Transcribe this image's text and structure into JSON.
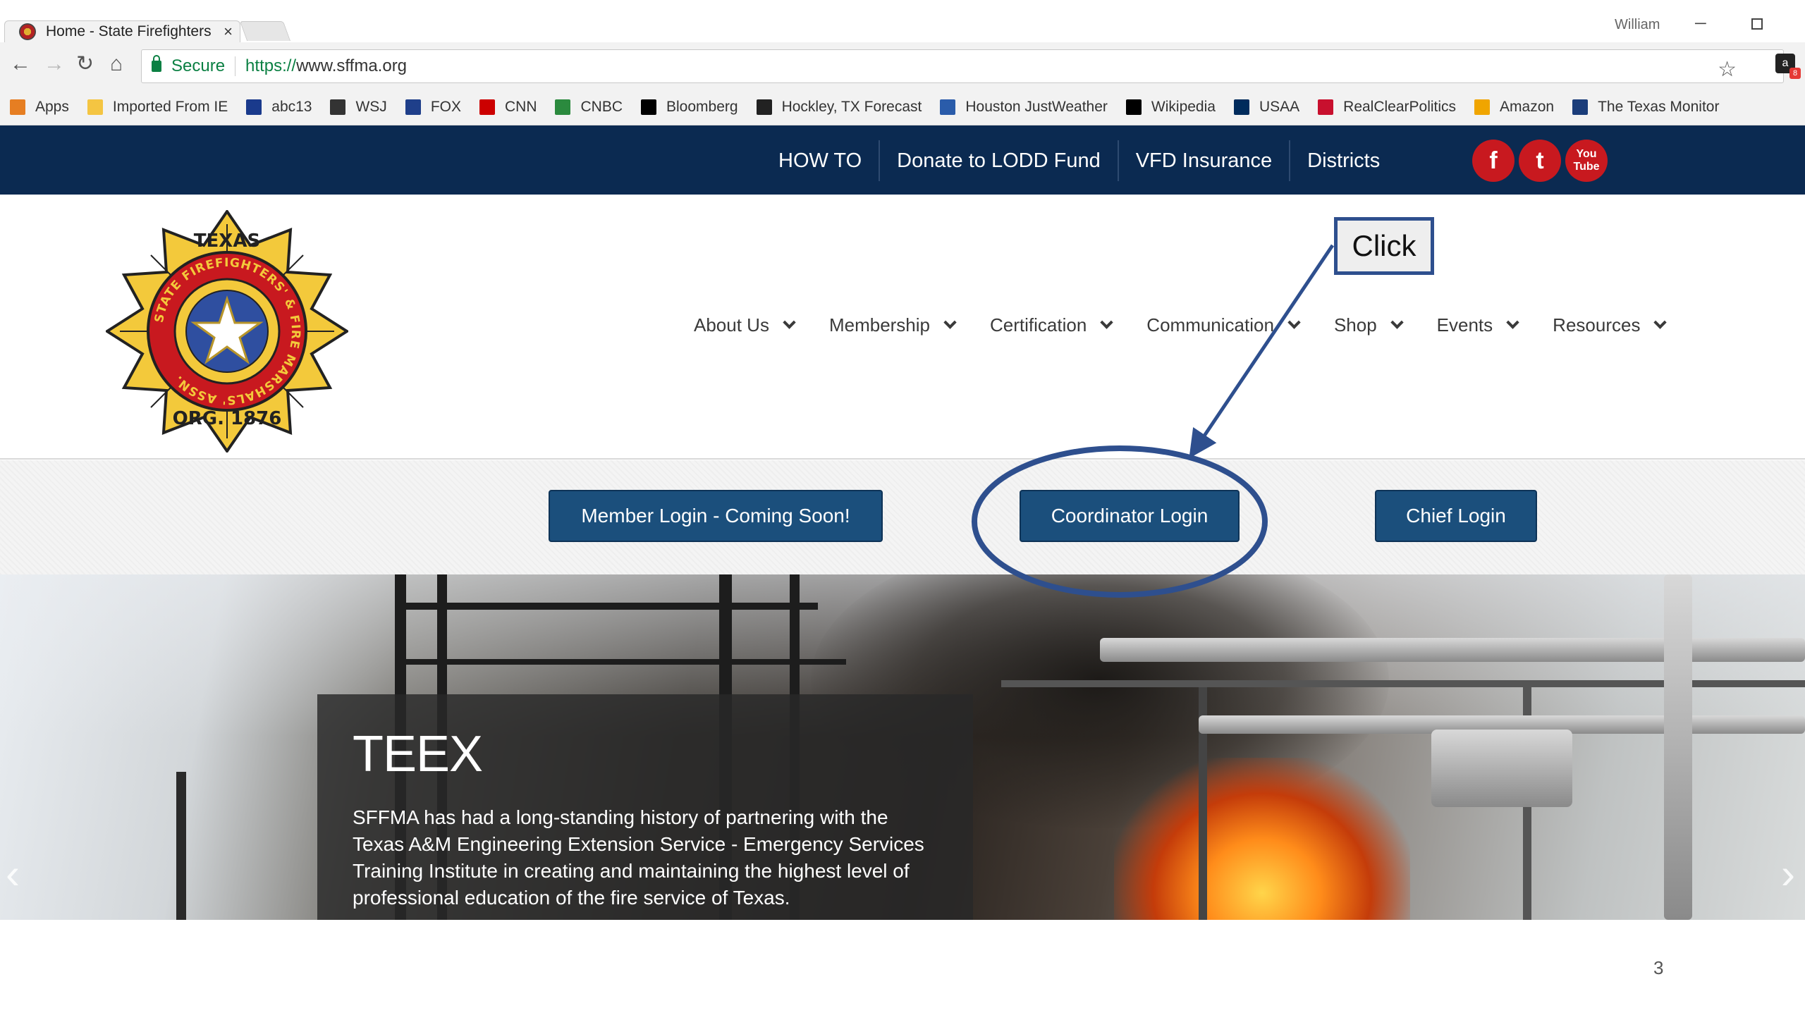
{
  "browser": {
    "tab_title": "Home - State Firefighters",
    "tab_close": "×",
    "user_name": "William",
    "minimize": "─",
    "secure_label": "Secure",
    "url_protocol": "https://",
    "url_host": "www.sffma.org",
    "nav": {
      "back": "←",
      "forward": "→",
      "reload": "↻",
      "home": "⌂"
    },
    "star": "☆",
    "bookmarks": [
      {
        "label": "Apps",
        "icon": "apps-grid-icon",
        "color": "#e67e22"
      },
      {
        "label": "Imported From IE",
        "icon": "folder-icon",
        "color": "#f4c542"
      },
      {
        "label": "abc13",
        "icon": "abc13-icon",
        "color": "#1a3a8c"
      },
      {
        "label": "WSJ",
        "icon": "wsj-icon",
        "color": "#333333"
      },
      {
        "label": "FOX",
        "icon": "fox-icon",
        "color": "#1f3f8a"
      },
      {
        "label": "CNN",
        "icon": "cnn-icon",
        "color": "#cc0000"
      },
      {
        "label": "CNBC",
        "icon": "cnbc-peacock-icon",
        "color": "#2b8a3e"
      },
      {
        "label": "Bloomberg",
        "icon": "bloomberg-icon",
        "color": "#000000"
      },
      {
        "label": "Hockley, TX Forecast",
        "icon": "weather-underground-icon",
        "color": "#222222"
      },
      {
        "label": "Houston JustWeather",
        "icon": "justweather-icon",
        "color": "#2a5caa"
      },
      {
        "label": "Wikipedia",
        "icon": "wikipedia-icon",
        "color": "#000000"
      },
      {
        "label": "USAA",
        "icon": "usaa-icon",
        "color": "#002b5c"
      },
      {
        "label": "RealClearPolitics",
        "icon": "rcp-icon",
        "color": "#c8102e"
      },
      {
        "label": "Amazon",
        "icon": "amazon-icon",
        "color": "#f0a500"
      },
      {
        "label": "The Texas Monitor",
        "icon": "texas-monitor-icon",
        "color": "#1b3d7a"
      }
    ]
  },
  "site": {
    "colors": {
      "navy": "#0b2a51",
      "button": "#1b4f7c",
      "social": "#c8191f",
      "annotation": "#2e4f8e"
    },
    "top_links": [
      "HOW TO",
      "Donate to LODD Fund",
      "VFD Insurance",
      "Districts"
    ],
    "social": {
      "facebook": "f",
      "twitter": "t",
      "youtube_top": "You",
      "youtube_bottom": "Tube"
    },
    "logo": {
      "top_text": "TEXAS",
      "ring_text": "STATE FIREFIGHTERS' & FIRE MARSHALS' ASSN.",
      "bottom_text": "ORG. 1876"
    },
    "main_nav": [
      "About Us",
      "Membership",
      "Certification",
      "Communication",
      "Shop",
      "Events",
      "Resources"
    ],
    "logins": {
      "member": "Member Login - Coming Soon!",
      "coordinator": "Coordinator Login",
      "chief": "Chief Login"
    },
    "hero": {
      "title": "TEEX",
      "text": "SFFMA has had a long-standing history of partnering with the Texas A&M Engineering Extension Service - Emergency Services Training Institute in creating and maintaining the highest level of professional education of the fire service of Texas.",
      "prev": "‹",
      "next": "›"
    }
  },
  "annotation": {
    "callout_text": "Click"
  },
  "slide_number": "3"
}
